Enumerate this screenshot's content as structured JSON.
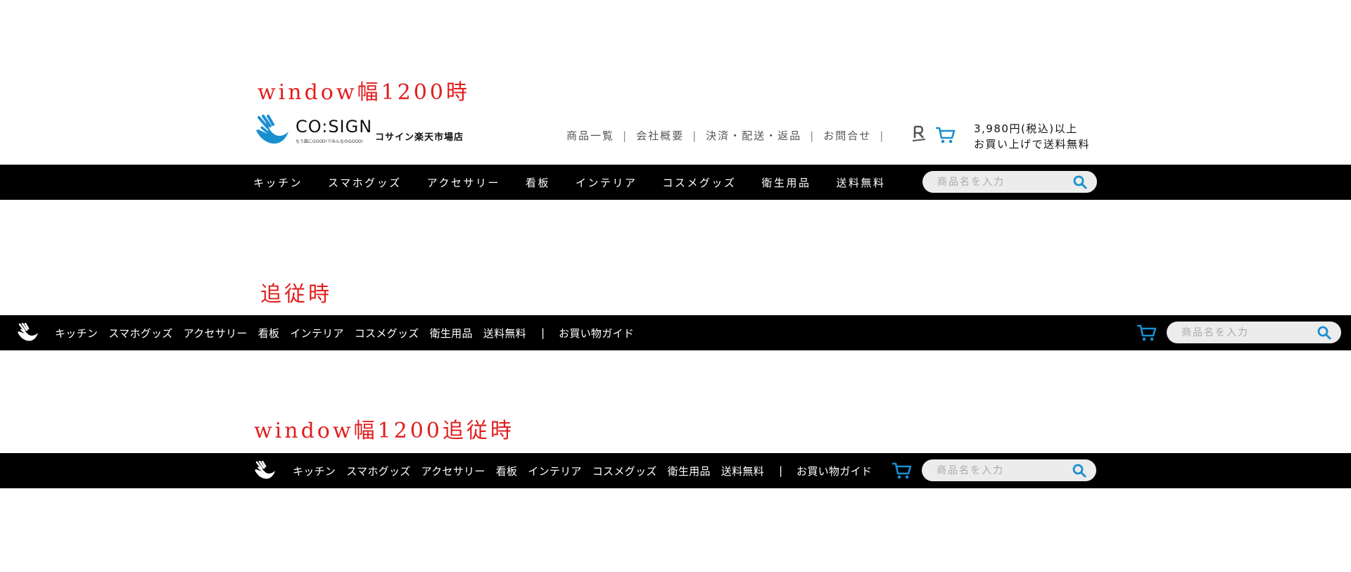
{
  "labels": {
    "section1": "window幅1200時",
    "section2": "追従時",
    "section3": "window幅1200追従時"
  },
  "header": {
    "logo_wordmark": "CO:SIGN",
    "logo_sub": "もう誰にGOOD!でみんなのGOOD!",
    "shop_name": "コサイン楽天市場店",
    "links": [
      "商品一覧",
      "会社概要",
      "決済・配送・返品",
      "お問合せ"
    ],
    "separator": "|",
    "rakuten_icon": "rakuten-r-icon",
    "cart_icon": "cart-icon",
    "shipping_line1": "3,980円(税込)以上",
    "shipping_line2": "お買い上げで送料無料"
  },
  "nav": {
    "items": [
      "キッチン",
      "スマホグッズ",
      "アクセサリー",
      "看板",
      "インテリア",
      "コスメグッズ",
      "衛生用品",
      "送料無料"
    ],
    "guide": "お買い物ガイド",
    "separator": "|"
  },
  "search": {
    "placeholder": "商品名を入力",
    "icon": "search-icon"
  },
  "colors": {
    "accent": "#1a8fd0",
    "label_red": "#e21d1d",
    "bar": "#000000",
    "search_bg": "#ececec"
  }
}
